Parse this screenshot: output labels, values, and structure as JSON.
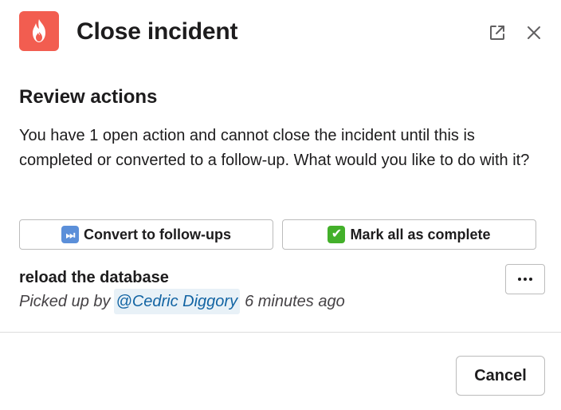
{
  "header": {
    "title": "Close incident",
    "app_icon": "flame-icon",
    "popout_icon": "external-link-icon",
    "close_icon": "close-icon"
  },
  "section": {
    "title": "Review actions",
    "description": "You have 1 open action and cannot close the incident until this is completed or converted to a follow-up. What would you like to do with it?"
  },
  "bulk_actions": {
    "convert": {
      "emoji": "⏭",
      "label": "Convert to follow-ups"
    },
    "complete": {
      "emoji": "✔",
      "label": "Mark all as complete"
    }
  },
  "action_item": {
    "name": "reload the database",
    "picked_up_prefix": "Picked up by",
    "assignee": "@Cedric Diggory",
    "time": "6 minutes ago",
    "more_icon": "ellipsis-icon"
  },
  "footer": {
    "cancel_label": "Cancel"
  },
  "colors": {
    "brand": "#f25d50",
    "mention_bg": "#e8f1f7",
    "mention_text": "#1264a3",
    "check_green": "#43b02a",
    "forward_blue": "#5b8fd9"
  }
}
